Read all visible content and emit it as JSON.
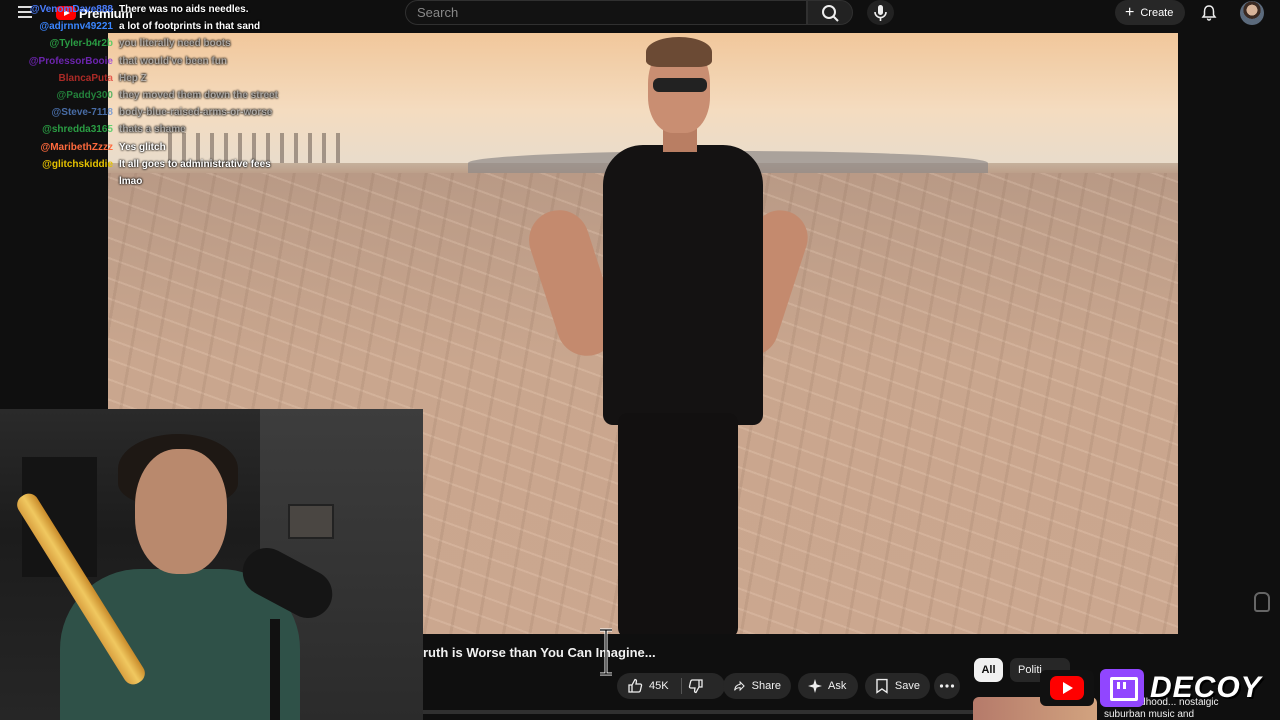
{
  "topbar": {
    "logo_text": "Premium",
    "search_placeholder": "Search",
    "create_label": "Create"
  },
  "chat": [
    {
      "user": "@VenomDave888",
      "message": "There was no aids needles.",
      "user_color": "#4a7dff",
      "dim": false
    },
    {
      "user": "@adjrnnv49221",
      "message": "a lot of footprints in that sand",
      "user_color": "#3a86ff",
      "dim": false
    },
    {
      "user": "@Tyler-b4r2b",
      "message": "you literally need boots",
      "user_color": "#33cc55",
      "dim": true
    },
    {
      "user": "@ProfessorBooie",
      "message": "that would've been fun",
      "user_color": "#8a2be2",
      "dim": true
    },
    {
      "user": "BlancaPuta",
      "message": "Hep Z",
      "user_color": "#e0342e",
      "dim": true
    },
    {
      "user": "@Paddy300",
      "message": "they moved them down the street",
      "user_color": "#2aa84a",
      "dim": true
    },
    {
      "user": "@Steve-7118",
      "message": "body-blue-raised-arms-or-worse",
      "user_color": "#5b8bd8",
      "dim": true
    },
    {
      "user": "@shredda3165",
      "message": "thats a shame",
      "user_color": "#33cc55",
      "dim": true
    },
    {
      "user": "@MaribethZzzz",
      "message": "Yes glitch",
      "user_color": "#ff6a3d",
      "dim": false
    },
    {
      "user": "@glitchskiddie",
      "message": "It all goes to administrative fees",
      "user_color": "#e5c200",
      "dim": false
    },
    {
      "user": "",
      "message": "lmao",
      "user_color": "#ffffff",
      "dim": false
    }
  ],
  "video": {
    "title": "ruth is Worse than You Can Imagine..."
  },
  "actions": {
    "likes": "45K",
    "share": "Share",
    "ask": "Ask",
    "save": "Save"
  },
  "chips": {
    "all": "All",
    "politics": "Politi"
  },
  "recommendation": {
    "title": "ovie childhood... nostalgic suburban music and"
  },
  "branding": {
    "name": "DECOY"
  }
}
